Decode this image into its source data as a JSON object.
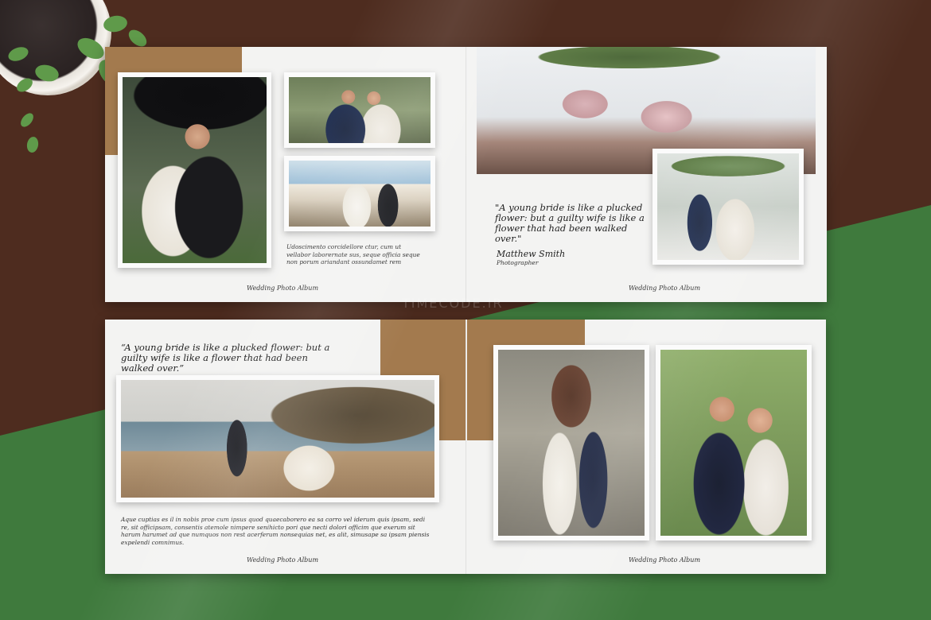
{
  "album": {
    "spread1": {
      "left_lorem": "Udoscimento corcidellore ctur, cum ut vellabor laborernate sus, seque officia seque non porum ariandant ossundamet rem",
      "left_footer": "Wedding Photo Album",
      "right_quote": "\"A young bride is like a plucked flower: but a guilty wife is like a flower that had been walked over.\"",
      "author_name": "Matthew Smith",
      "author_role": "Photographer",
      "right_footer": "Wedding Photo Album"
    },
    "spread2": {
      "left_quote": "“A young bride is like a plucked flower: but a guilty wife is like a flower that had been walked over.”",
      "left_lorem": "Aque cuptias es il in nobis proe cum ipsus quod quaecaborero ea sa corro vel iderum quis ipsam, sedi re, sit officipsam, consentis atemole nimpere senihicto pori que necti dolori officim que exerum sit harum harumet ad que numquos non rest acerferum nonsequias net, es alit, simusape sa ipsam piensis expelendi comnimus.",
      "left_footer": "Wedding Photo Album",
      "right_footer": "Wedding Photo Album"
    }
  },
  "watermark": "TIMECODE.IR",
  "colors": {
    "brown_bg": "#4e2c1f",
    "green_bg": "#3f7a3d",
    "gold_block": "#a37a4e",
    "paper": "#f3f3f2"
  }
}
